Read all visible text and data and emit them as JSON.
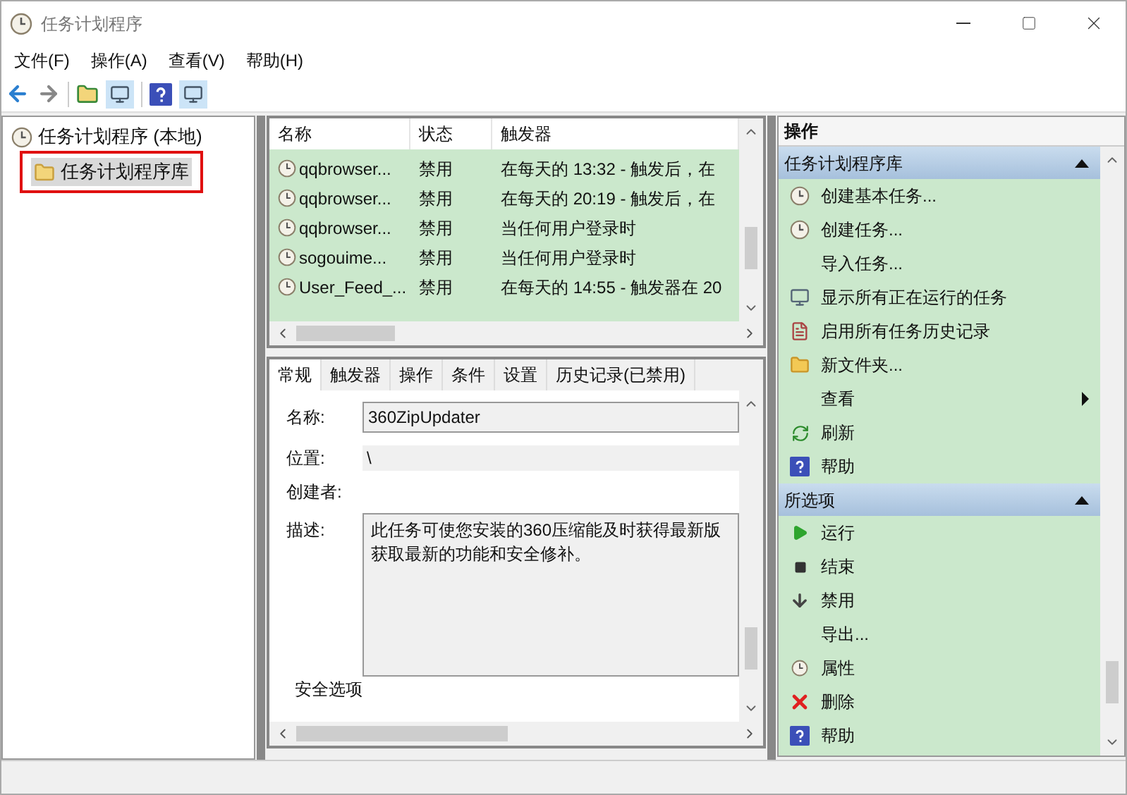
{
  "window": {
    "title": "任务计划程序"
  },
  "menu": [
    "文件(F)",
    "操作(A)",
    "查看(V)",
    "帮助(H)"
  ],
  "tree": [
    {
      "label": "任务计划程序 (本地)",
      "selected": false,
      "children": [
        {
          "label": "任务计划程序库",
          "selected": true
        }
      ]
    }
  ],
  "task_table": {
    "columns": [
      "名称",
      "状态",
      "触发器"
    ],
    "rows": [
      [
        "qqbrowser...",
        "禁用",
        "在每天的 13:32 - 触发后，在 "
      ],
      [
        "qqbrowser...",
        "禁用",
        "在每天的 20:19 - 触发后，在 "
      ],
      [
        "qqbrowser...",
        "禁用",
        "当任何用户登录时"
      ],
      [
        "sogouime...",
        "禁用",
        "当任何用户登录时"
      ],
      [
        "User_Feed_...",
        "禁用",
        "在每天的 14:55 - 触发器在 20"
      ]
    ]
  },
  "detail_tabs": [
    {
      "label": "常规",
      "selected": true
    },
    {
      "label": "触发器",
      "selected": false
    },
    {
      "label": "操作",
      "selected": false
    },
    {
      "label": "条件",
      "selected": false
    },
    {
      "label": "设置",
      "selected": false
    },
    {
      "label": "历史记录(已禁用)",
      "selected": false
    }
  ],
  "general": {
    "name_label": "名称:",
    "name_value": "360ZipUpdater",
    "location_label": "位置:",
    "location_value": "\\",
    "author_label": "创建者:",
    "description_label": "描述:",
    "description_lines": [
      "此任务可使您安装的360压缩能及时获得最新版",
      "获取最新的功能和安全修补。"
    ],
    "security_label": "安全选项"
  },
  "actions": {
    "title": "操作",
    "groups": [
      {
        "title": "任务计划程序库",
        "expanded": true,
        "items": [
          {
            "label": "创建基本任务..."
          },
          {
            "label": "创建任务..."
          },
          {
            "label": "导入任务..."
          },
          {
            "label": "显示所有正在运行的任务"
          },
          {
            "label": "启用所有任务历史记录"
          },
          {
            "label": "新文件夹..."
          },
          {
            "label": "查看",
            "submenu": true
          },
          {
            "label": "刷新"
          },
          {
            "label": "帮助"
          }
        ]
      },
      {
        "title": "所选项",
        "expanded": true,
        "items": [
          {
            "label": "运行"
          },
          {
            "label": "结束"
          },
          {
            "label": "禁用"
          },
          {
            "label": "导出..."
          },
          {
            "label": "属性"
          },
          {
            "label": "删除"
          },
          {
            "label": "帮助"
          }
        ]
      }
    ]
  }
}
